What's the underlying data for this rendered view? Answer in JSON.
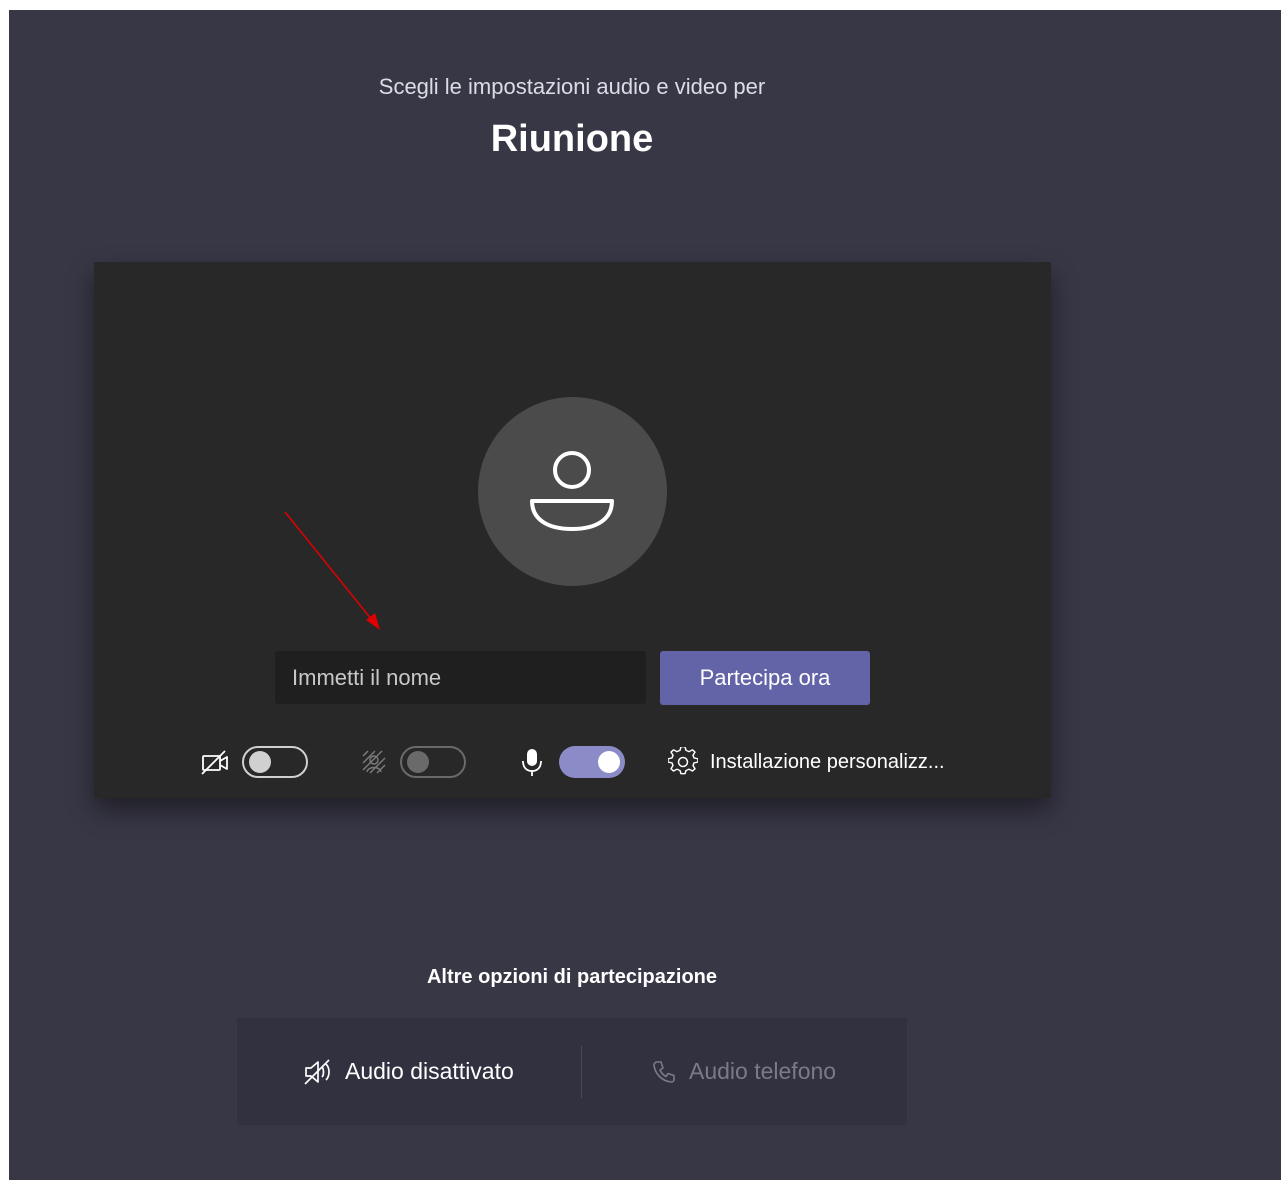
{
  "header": {
    "subtitle": "Scegli le impostazioni audio e video per",
    "meeting_title": "Riunione"
  },
  "preview": {
    "avatar_icon": "person-icon",
    "name_input": {
      "value": "",
      "placeholder": "Immetti il nome"
    },
    "join_button_label": "Partecipa ora",
    "controls": {
      "camera": {
        "icon": "camera-off-icon",
        "state": "off"
      },
      "background_effects": {
        "icon": "background-blur-icon",
        "state": "disabled"
      },
      "microphone": {
        "icon": "microphone-icon",
        "state": "on"
      },
      "custom_setup_label": "Installazione personalizz...",
      "custom_setup_icon": "gear-icon"
    }
  },
  "other_options": {
    "title": "Altre opzioni di partecipazione",
    "audio_off": {
      "label": "Audio disattivato",
      "icon": "speaker-off-icon"
    },
    "phone_audio": {
      "label": "Audio telefono",
      "icon": "phone-icon"
    }
  },
  "annotation": {
    "arrow_color": "#e00000"
  },
  "colors": {
    "background": "#383746",
    "panel": "#282828",
    "accent": "#6264a7",
    "toggle_on": "#8b8cc7"
  }
}
